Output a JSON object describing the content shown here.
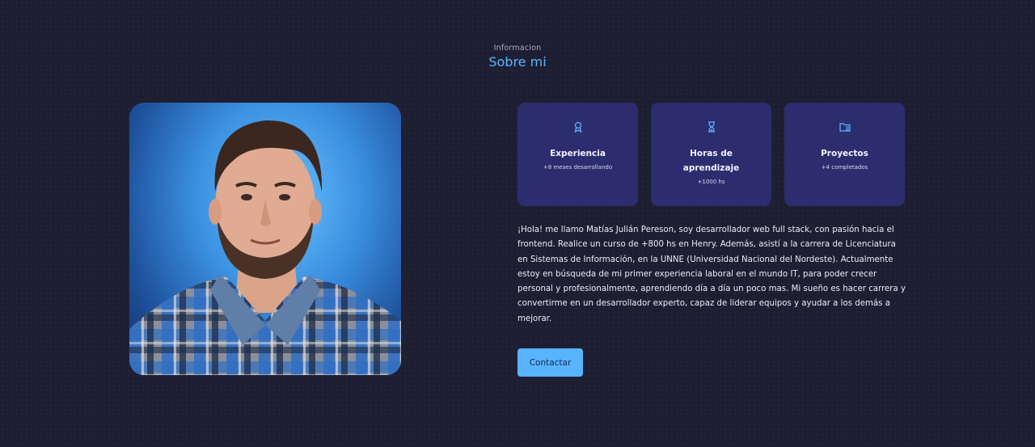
{
  "header": {
    "subtitle": "Informacion",
    "title": "Sobre mi"
  },
  "photo": {
    "alt": "Foto de perfil"
  },
  "cards": [
    {
      "icon": "award-icon",
      "title": "Experiencia",
      "subtitle": "+8 meses desarrollando"
    },
    {
      "icon": "hourglass-icon",
      "title": "Horas de aprendizaje",
      "subtitle": "+1000 hs"
    },
    {
      "icon": "folder-icon",
      "title": "Proyectos",
      "subtitle": "+4 completados"
    }
  ],
  "description": "¡Hola! me llamo Matías Julián Pereson, soy desarrollador web full stack, con pasión hacia el frontend. Realice un curso de +800 hs en Henry. Además, asistí a la carrera de Licenciatura en Sistemas de Información, en la UNNE (Universidad Nacional del Nordeste). Actualmente estoy en búsqueda de mi primer experiencia laboral en el mundo IT, para poder crecer personal y profesionalmente, aprendiendo día a día un poco mas. Mi sueño es hacer carrera y convertirme en un desarrollador experto, capaz de liderar equipos y ayudar a los demás a mejorar.",
  "contact_button": "Contactar",
  "colors": {
    "background": "#1e1e33",
    "accent": "#55b6ff",
    "card": "#2c2d6e",
    "button": "#58b4ff"
  }
}
